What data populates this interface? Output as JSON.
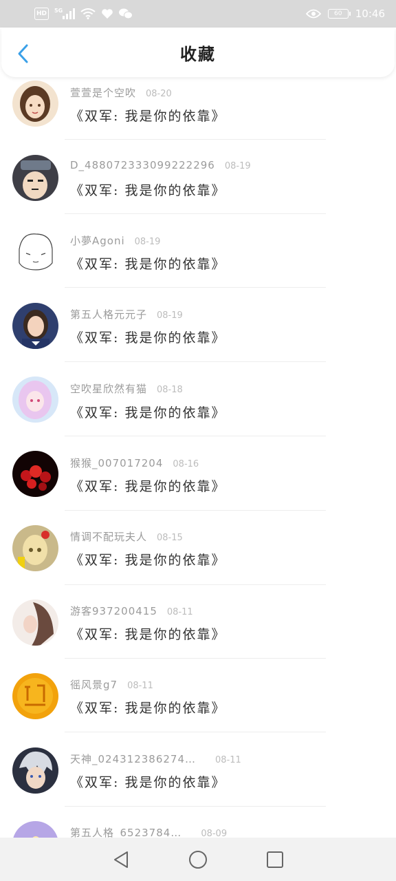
{
  "status_bar": {
    "hd": "HD",
    "network": "5G",
    "battery": "60",
    "time": "10:46"
  },
  "header": {
    "title": "收藏"
  },
  "items": [
    {
      "username": "萱萱是个空吹",
      "date": "08-20",
      "title": "《双军:  我是你的依靠》"
    },
    {
      "username": "D_488072333099222296",
      "date": "08-19",
      "title": "《双军:  我是你的依靠》"
    },
    {
      "username": "小夢Agoni",
      "date": "08-19",
      "title": "《双军:  我是你的依靠》"
    },
    {
      "username": "第五人格元元子",
      "date": "08-19",
      "title": "《双军:  我是你的依靠》"
    },
    {
      "username": "空吹星欣然有猫",
      "date": "08-18",
      "title": "《双军:  我是你的依靠》"
    },
    {
      "username": "猴猴_007017204",
      "date": "08-16",
      "title": "《双军:  我是你的依靠》"
    },
    {
      "username": "情调不配玩夫人",
      "date": "08-15",
      "title": "《双军:  我是你的依靠》"
    },
    {
      "username": "游客937200415",
      "date": "08-11",
      "title": "《双军:  我是你的依靠》"
    },
    {
      "username": "徭风景g7",
      "date": "08-11",
      "title": "《双军:  我是你的依靠》"
    },
    {
      "username": "天神_024312386274…",
      "date": "08-11",
      "title": "《双军:  我是你的依靠》"
    },
    {
      "username": "第五人格_6523784…",
      "date": "08-09",
      "title": ""
    }
  ],
  "colors": {
    "status_bar_bg": "#d9d9d9",
    "accent_back": "#3aa0e8",
    "username": "#9b9b9b",
    "date": "#bcbcbc"
  },
  "icons": {
    "back": "chevron-left-icon",
    "nav_back": "triangle-back-icon",
    "nav_home": "circle-home-icon",
    "nav_recent": "square-recent-icon"
  }
}
